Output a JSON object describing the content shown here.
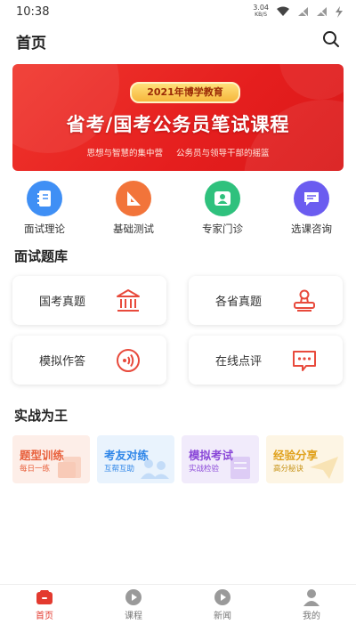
{
  "status_bar": {
    "time": "10:38",
    "net_speed_value": "3.04",
    "net_speed_unit": "KB/S"
  },
  "header": {
    "title": "首页"
  },
  "banner": {
    "tag": "2021年博学教育",
    "headline": "省考/国考公务员笔试课程",
    "subtitle_left": "思想与智慧的集中营",
    "subtitle_right": "公务员与领导干部的摇篮",
    "bg_color": "#e82a24"
  },
  "quick_actions": [
    {
      "label": "面试理论",
      "icon": "notebook-icon",
      "color": "#3f8ff5"
    },
    {
      "label": "基础测试",
      "icon": "ruler-triangle-icon",
      "color": "#f2743a"
    },
    {
      "label": "专家门诊",
      "icon": "person-icon",
      "color": "#2fc17d"
    },
    {
      "label": "选课咨询",
      "icon": "chat-icon",
      "color": "#6b5cf0"
    }
  ],
  "interview_bank": {
    "title": "面试题库",
    "items": [
      {
        "label": "国考真题",
        "icon": "building-icon"
      },
      {
        "label": "各省真题",
        "icon": "stamp-icon"
      },
      {
        "label": "模拟作答",
        "icon": "audio-wave-icon"
      },
      {
        "label": "在线点评",
        "icon": "comment-icon"
      }
    ],
    "accent_color": "#e84a3c"
  },
  "practice": {
    "title": "实战为王",
    "items": [
      {
        "title": "题型训练",
        "subtitle": "每日一练",
        "title_color": "#e8603c",
        "sub_color": "#e8603c",
        "bg": "#fdeee8"
      },
      {
        "title": "考友对练",
        "subtitle": "互帮互助",
        "title_color": "#2f86e8",
        "sub_color": "#2f86e8",
        "bg": "#e9f3fd"
      },
      {
        "title": "模拟考试",
        "subtitle": "实战检验",
        "title_color": "#8a48d8",
        "sub_color": "#8a48d8",
        "bg": "#f1ebfb"
      },
      {
        "title": "经验分享",
        "subtitle": "高分秘诀",
        "title_color": "#e0a21e",
        "sub_color": "#c79316",
        "bg": "#fdf5e4"
      }
    ]
  },
  "tab_bar": {
    "tabs": [
      {
        "label": "首页",
        "icon": "home-icon",
        "active": true
      },
      {
        "label": "课程",
        "icon": "play-circle-icon",
        "active": false
      },
      {
        "label": "新闻",
        "icon": "play-circle-icon",
        "active": false
      },
      {
        "label": "我的",
        "icon": "user-icon",
        "active": false
      }
    ],
    "active_color": "#e33a2f"
  }
}
